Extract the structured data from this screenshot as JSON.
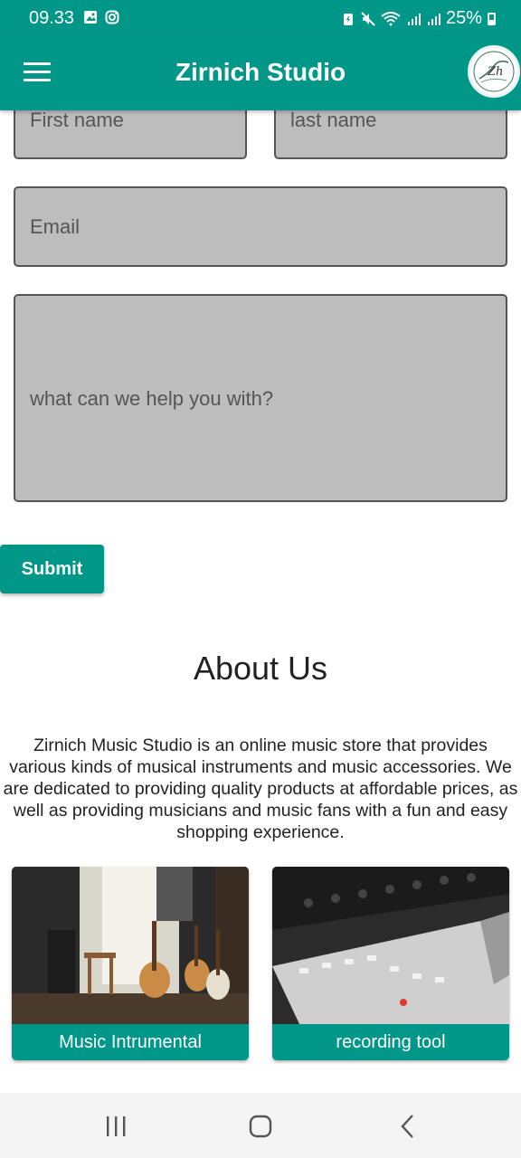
{
  "status_bar": {
    "time": "09.33",
    "battery": "25%",
    "left_icons": [
      "image-icon",
      "instagram-icon"
    ],
    "right_icons": [
      "battery-saver-icon",
      "mute-icon",
      "wifi-icon",
      "signal-icon",
      "signal-icon",
      "battery-icon"
    ]
  },
  "app_bar": {
    "title": "Zirnich Studio",
    "menu_icon": "hamburger-menu-icon",
    "logo_text": "Zh"
  },
  "form": {
    "first_name_placeholder": "First name",
    "last_name_placeholder": "last name",
    "email_placeholder": "Email",
    "message_placeholder": "what can we help you with?",
    "submit_label": "Submit"
  },
  "about": {
    "title": "About Us",
    "text": "Zirnich Music Studio is an online music store that provides various kinds of musical instruments and music accessories. We are dedicated to providing quality products at affordable prices, as well as providing musicians and music fans with a fun and easy shopping experience."
  },
  "categories": [
    {
      "label": "Music Intrumental"
    },
    {
      "label": "recording tool"
    }
  ],
  "colors": {
    "primary": "#009688",
    "field_bg": "#bdbdbd"
  }
}
